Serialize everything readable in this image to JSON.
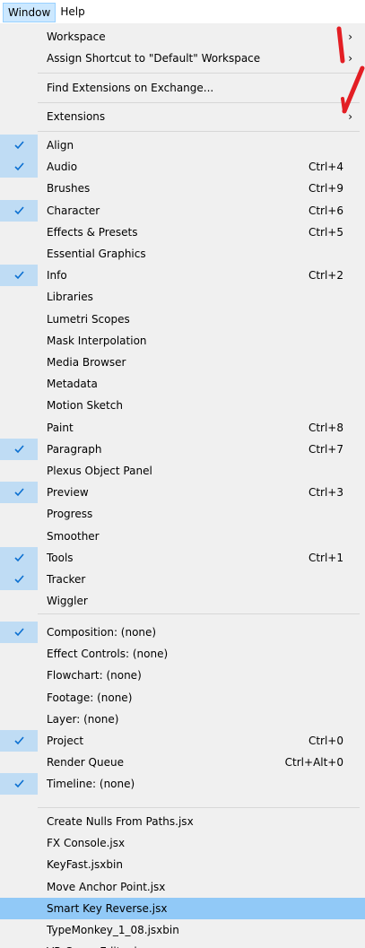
{
  "menubar": {
    "window_label": "Window",
    "help_label": "Help"
  },
  "menu": {
    "workspace": "Workspace",
    "assign_shortcut": "Assign Shortcut to \"Default\" Workspace",
    "find_extensions": "Find Extensions on Exchange...",
    "extensions": "Extensions",
    "panels": [
      {
        "label": "Align",
        "checked": true,
        "shortcut": ""
      },
      {
        "label": "Audio",
        "checked": true,
        "shortcut": "Ctrl+4"
      },
      {
        "label": "Brushes",
        "checked": false,
        "shortcut": "Ctrl+9"
      },
      {
        "label": "Character",
        "checked": true,
        "shortcut": "Ctrl+6"
      },
      {
        "label": "Effects & Presets",
        "checked": false,
        "shortcut": "Ctrl+5"
      },
      {
        "label": "Essential Graphics",
        "checked": false,
        "shortcut": ""
      },
      {
        "label": "Info",
        "checked": true,
        "shortcut": "Ctrl+2"
      },
      {
        "label": "Libraries",
        "checked": false,
        "shortcut": ""
      },
      {
        "label": "Lumetri Scopes",
        "checked": false,
        "shortcut": ""
      },
      {
        "label": "Mask Interpolation",
        "checked": false,
        "shortcut": ""
      },
      {
        "label": "Media Browser",
        "checked": false,
        "shortcut": ""
      },
      {
        "label": "Metadata",
        "checked": false,
        "shortcut": ""
      },
      {
        "label": "Motion Sketch",
        "checked": false,
        "shortcut": ""
      },
      {
        "label": "Paint",
        "checked": false,
        "shortcut": "Ctrl+8"
      },
      {
        "label": "Paragraph",
        "checked": true,
        "shortcut": "Ctrl+7"
      },
      {
        "label": "Plexus Object Panel",
        "checked": false,
        "shortcut": ""
      },
      {
        "label": "Preview",
        "checked": true,
        "shortcut": "Ctrl+3"
      },
      {
        "label": "Progress",
        "checked": false,
        "shortcut": ""
      },
      {
        "label": "Smoother",
        "checked": false,
        "shortcut": ""
      },
      {
        "label": "Tools",
        "checked": true,
        "shortcut": "Ctrl+1"
      },
      {
        "label": "Tracker",
        "checked": true,
        "shortcut": ""
      },
      {
        "label": "Wiggler",
        "checked": false,
        "shortcut": ""
      }
    ],
    "viewers": [
      {
        "label": "Composition: (none)",
        "checked": true,
        "shortcut": ""
      },
      {
        "label": "Effect Controls: (none)",
        "checked": false,
        "shortcut": ""
      },
      {
        "label": "Flowchart: (none)",
        "checked": false,
        "shortcut": ""
      },
      {
        "label": "Footage: (none)",
        "checked": false,
        "shortcut": ""
      },
      {
        "label": "Layer: (none)",
        "checked": false,
        "shortcut": ""
      },
      {
        "label": "Project",
        "checked": true,
        "shortcut": "Ctrl+0"
      },
      {
        "label": "Render Queue",
        "checked": false,
        "shortcut": "Ctrl+Alt+0"
      },
      {
        "label": "Timeline: (none)",
        "checked": true,
        "shortcut": ""
      }
    ],
    "scripts": [
      {
        "label": "Create Nulls From Paths.jsx",
        "highlighted": false
      },
      {
        "label": "FX Console.jsx",
        "highlighted": false
      },
      {
        "label": "KeyFast.jsxbin",
        "highlighted": false
      },
      {
        "label": "Move Anchor Point.jsx",
        "highlighted": false
      },
      {
        "label": "Smart Key Reverse.jsx",
        "highlighted": true
      },
      {
        "label": "TypeMonkey_1_08.jsxbin",
        "highlighted": false
      },
      {
        "label": "VR Comp Editor.jsx",
        "highlighted": false
      }
    ]
  },
  "colors": {
    "menu_bg": "#f0f0f0",
    "check_bg": "#bfdcf4",
    "highlight": "#91c9f7",
    "check_mark": "#0a6fd1",
    "annotation_red": "#e31e24"
  }
}
